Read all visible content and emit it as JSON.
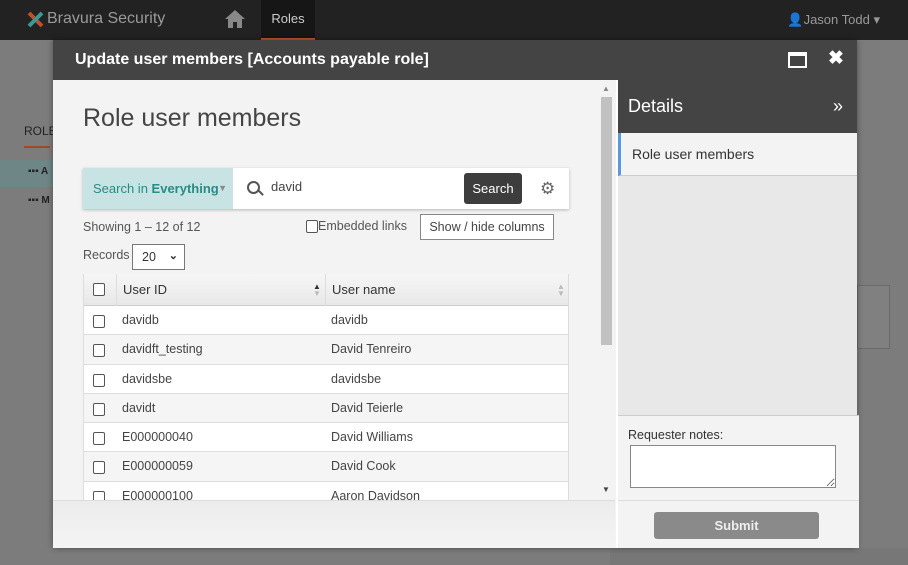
{
  "topbar": {
    "brand": "Bravura Security",
    "nav_roles": "Roles",
    "user": "Jason Todd"
  },
  "background": {
    "section": "ROLE",
    "items": [
      "A",
      "M"
    ]
  },
  "modal": {
    "title": "Update user members [Accounts payable role]",
    "heading": "Role user members",
    "search": {
      "scope_prefix": "Search in",
      "scope_value": "Everything",
      "query": "david",
      "button": "Search"
    },
    "showing": "Showing 1 – 12 of 12",
    "embedded_links": "Embedded links",
    "show_hide": "Show / hide columns",
    "records_label": "Records",
    "records_value": "20",
    "columns": [
      "User ID",
      "User name"
    ],
    "rows": [
      {
        "id": "davidb",
        "name": "davidb"
      },
      {
        "id": "davidft_testing",
        "name": "David Tenreiro"
      },
      {
        "id": "davidsbe",
        "name": "davidsbe"
      },
      {
        "id": "davidt",
        "name": "David Teierle"
      },
      {
        "id": "E000000040",
        "name": "David Williams"
      },
      {
        "id": "E000000059",
        "name": "David Cook"
      },
      {
        "id": "E000000100",
        "name": "Aaron Davidson"
      }
    ]
  },
  "details": {
    "title": "Details",
    "item": "Role user members",
    "notes_label": "Requester notes:",
    "notes_value": "",
    "submit": "Submit"
  },
  "colors": {
    "topbar": "#222222",
    "modal_header": "#444444",
    "scope_bg": "#c8e3e3",
    "scope_text": "#2a8a85",
    "accent": "#c0502a",
    "active_item": "#5b9bd5"
  }
}
